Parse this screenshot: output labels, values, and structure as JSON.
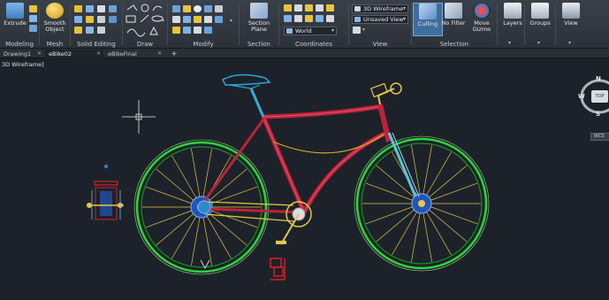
{
  "ribbon": {
    "groups": [
      {
        "key": "modeling",
        "label": "Modeling",
        "big": "Extrude"
      },
      {
        "key": "mesh",
        "label": "Mesh",
        "big": "Smooth Object"
      },
      {
        "key": "solid_editing",
        "label": "Solid Editing"
      },
      {
        "key": "draw",
        "label": "Draw"
      },
      {
        "key": "modify",
        "label": "Modify"
      },
      {
        "key": "section",
        "label": "Section",
        "big": "Section Plane"
      },
      {
        "key": "coordinates",
        "label": "Coordinates",
        "combo": "World"
      },
      {
        "key": "view",
        "label": "View",
        "combo_style": "3D Wireframe",
        "combo_view": "Unsaved View"
      },
      {
        "key": "selection",
        "label": "Selection",
        "culling": "Culling",
        "nofilter": "No Filter",
        "gizmo": "Move Gizmo"
      },
      {
        "key": "layers",
        "label": "Layers"
      },
      {
        "key": "groups",
        "label": "Groups"
      },
      {
        "key": "viewpanel",
        "label": "View"
      }
    ]
  },
  "tabs": {
    "items": [
      "Drawing1",
      "eBike02",
      "eBikeFinal"
    ],
    "add_label": "+"
  },
  "viewport": {
    "label": "3D Wireframe]",
    "viewcube": {
      "north": "N",
      "west": "W",
      "south": "S",
      "face": "TOP",
      "wcs": "WCS"
    }
  },
  "colors": {
    "frame": "#c0213a",
    "wheel": "#1fbf2a",
    "spokes": "#e3c84a",
    "handlebar": "#2aa7d6",
    "fork": "#5ec3d9",
    "accent_red": "#d11f2a"
  }
}
